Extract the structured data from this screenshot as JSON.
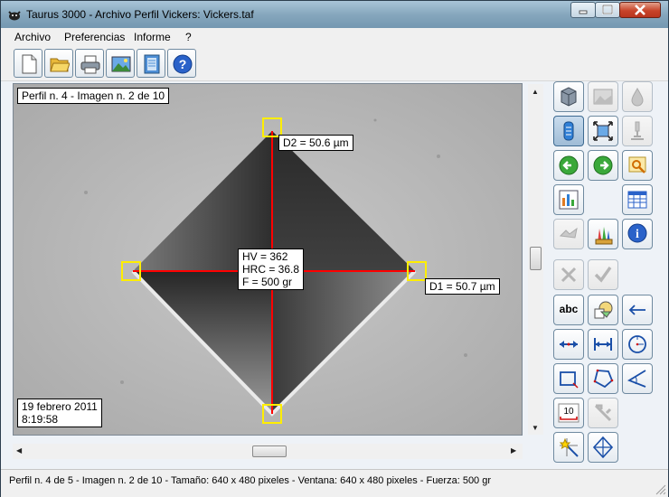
{
  "window": {
    "title": "Taurus 3000 - Archivo Perfil Vickers: Vickers.taf",
    "icon": "taurus-app-icon",
    "controls": [
      "minimize-icon",
      "maximize-icon",
      "close-icon"
    ]
  },
  "menu": {
    "items": [
      "Archivo",
      "Preferencias",
      "Informe",
      "?"
    ]
  },
  "toolbar": {
    "buttons": [
      "new-document-icon",
      "open-folder-icon",
      "print-icon",
      "image-icon",
      "notebook-icon",
      "help-icon"
    ]
  },
  "viewer": {
    "header": "Perfil n. 4 - Imagen n. 2 de 10",
    "d2_label": "D2 = 50.6  µm",
    "d1_label": "D1 = 50.7  µm",
    "results": {
      "hv": "HV = 362",
      "hrc": "HRC = 36.8",
      "force": "F = 500 gr"
    },
    "date": "19 febrero 2011",
    "time": "8:19:58",
    "marker_color": "#ffee00",
    "line_color": "#ff0000"
  },
  "panel": {
    "buttons": [
      {
        "name": "load-data-icon",
        "enabled": true
      },
      {
        "name": "image-acquire-icon",
        "enabled": false
      },
      {
        "name": "drop-icon",
        "enabled": false
      },
      {
        "name": "indenter-icon",
        "enabled": true,
        "active": true
      },
      {
        "name": "fit-image-icon",
        "enabled": true
      },
      {
        "name": "microscope-icon",
        "enabled": false
      },
      {
        "name": "prev-arrow-icon",
        "enabled": true
      },
      {
        "name": "next-arrow-icon",
        "enabled": true
      },
      {
        "name": "zoom-image-icon",
        "enabled": true
      },
      {
        "name": "chart-icon",
        "enabled": true
      },
      {
        "name": "table-icon",
        "enabled": true
      },
      {
        "name": "compare-icon",
        "enabled": false
      },
      {
        "name": "paint-icon",
        "enabled": true
      },
      {
        "name": "info-icon",
        "enabled": true
      },
      {
        "name": "cancel-icon",
        "enabled": false
      },
      {
        "name": "accept-icon",
        "enabled": false
      },
      {
        "name": "text-tool",
        "label": "abc",
        "enabled": true
      },
      {
        "name": "shapes-icon",
        "enabled": true
      },
      {
        "name": "arrow-left-icon",
        "enabled": true
      },
      {
        "name": "measure-outer-icon",
        "enabled": true
      },
      {
        "name": "measure-inner-icon",
        "enabled": true
      },
      {
        "name": "circle-measure-icon",
        "enabled": true
      },
      {
        "name": "rectangle-measure-icon",
        "enabled": true
      },
      {
        "name": "polygon-measure-icon",
        "enabled": true
      },
      {
        "name": "angle-measure-icon",
        "enabled": true
      },
      {
        "name": "scale-bar-tool",
        "label": "10",
        "enabled": true
      },
      {
        "name": "caliper-icon",
        "enabled": false
      },
      {
        "name": "magic-wand-icon",
        "enabled": true
      },
      {
        "name": "crosshair-icon",
        "enabled": true
      }
    ]
  },
  "status": {
    "text": "Perfil n. 4 de 5 - Imagen n. 2 de 10 - Tamaño: 640 x 480 pixeles - Ventana: 640 x 480 pixeles - Fuerza: 500 gr"
  }
}
